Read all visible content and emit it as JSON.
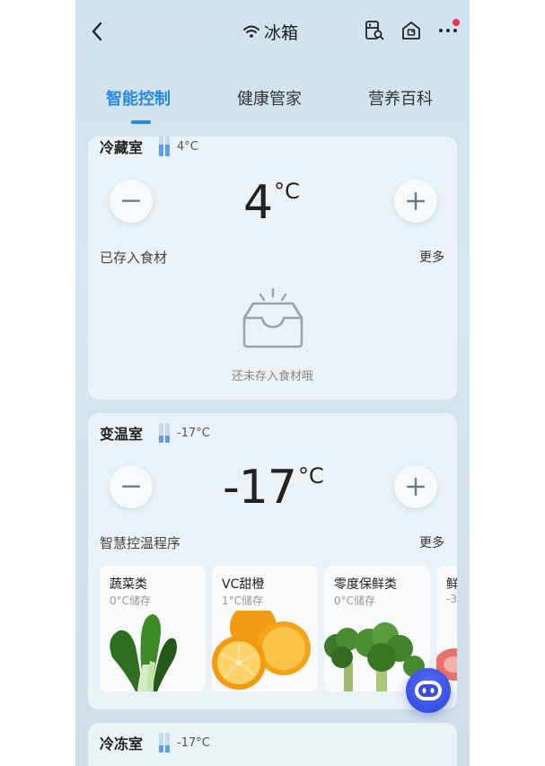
{
  "header": {
    "title": "冰箱",
    "icons": [
      "back-icon",
      "wifi-icon",
      "fridge-search-icon",
      "home-icon",
      "more-icon"
    ]
  },
  "tabs": [
    {
      "label": "智能控制",
      "active": true
    },
    {
      "label": "健康管家",
      "active": false
    },
    {
      "label": "营养百科",
      "active": false
    }
  ],
  "fridge_compartment": {
    "name": "冷藏室",
    "temp_small": "4°C",
    "temp_value": "4",
    "unit": "°C",
    "level_fraction": 0.6,
    "section_label": "已存入食材",
    "more": "更多",
    "empty_text": "还未存入食材哦"
  },
  "variable_compartment": {
    "name": "变温室",
    "temp_small": "-17°C",
    "temp_value": "-17",
    "unit": "°C",
    "level_fraction": 0.35,
    "section_label": "智慧控温程序",
    "more": "更多",
    "programs": [
      {
        "name": "蔬菜类",
        "sub": "0°C储存"
      },
      {
        "name": "VC甜橙",
        "sub": "1°C储存"
      },
      {
        "name": "零度保鲜类",
        "sub": "0°C储存"
      },
      {
        "name": "鲜",
        "sub": "-3"
      }
    ]
  },
  "freezer_compartment": {
    "name": "冷冻室",
    "temp_small": "-17°C",
    "level_fraction": 0.35
  },
  "colors": {
    "accent": "#2a86e0",
    "notification_dot": "#f0334a",
    "assistant": "#3c55e6"
  }
}
